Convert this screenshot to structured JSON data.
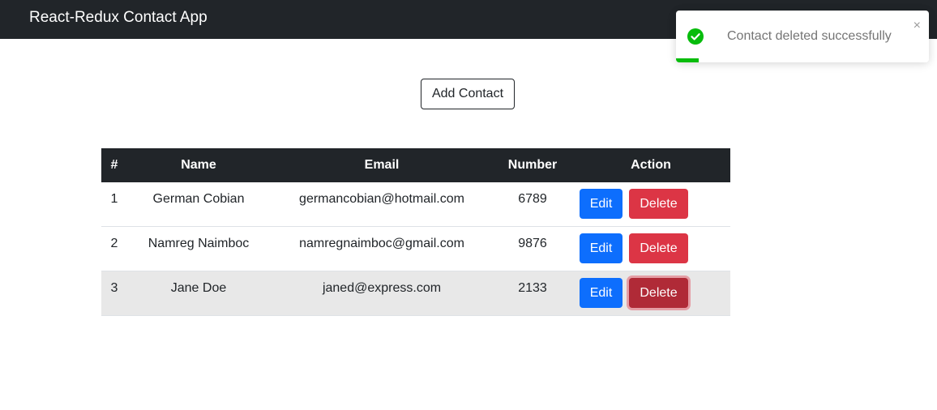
{
  "app": {
    "title": "React-Redux Contact App"
  },
  "main": {
    "add_button_label": "Add Contact"
  },
  "table": {
    "headers": [
      "#",
      "Name",
      "Email",
      "Number",
      "Action"
    ],
    "rows": [
      {
        "id": "1",
        "name": "German Cobian",
        "email": "germancobian@hotmail.com",
        "number": "6789",
        "edit_label": "Edit",
        "delete_label": "Delete"
      },
      {
        "id": "2",
        "name": "Namreg Naimboc",
        "email": "namregnaimboc@gmail.com",
        "number": "9876",
        "edit_label": "Edit",
        "delete_label": "Delete"
      },
      {
        "id": "3",
        "name": "Jane Doe",
        "email": "janed@express.com",
        "number": "2133",
        "edit_label": "Edit",
        "delete_label": "Delete"
      }
    ]
  },
  "toast": {
    "message": "Contact deleted successfully",
    "icon": "check-circle-icon",
    "close_glyph": "×",
    "progress": 0.09,
    "color": "#07bc0c"
  },
  "colors": {
    "navbar": "#212529",
    "edit": "#0d6efd",
    "delete": "#dc3545",
    "success": "#07bc0c"
  }
}
